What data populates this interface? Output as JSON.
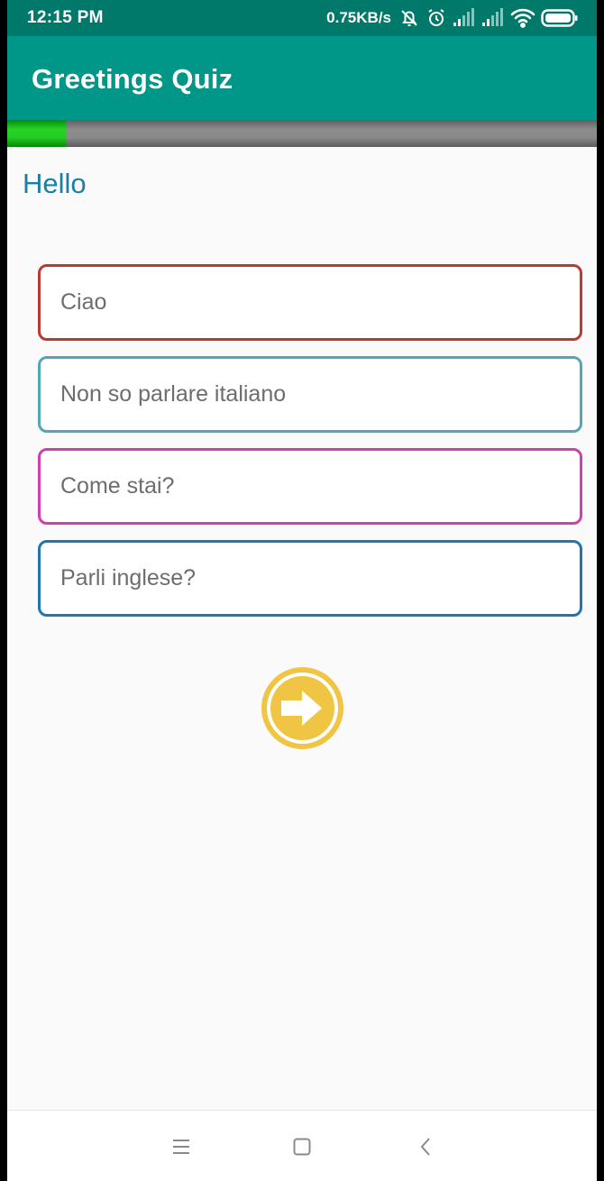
{
  "status_bar": {
    "time": "12:15 PM",
    "network_speed": "0.75KB/s",
    "icons": [
      "muted-bell-icon",
      "alarm-icon",
      "signal-icon",
      "signal-icon",
      "wifi-icon",
      "battery-icon"
    ]
  },
  "app_bar": {
    "title": "Greetings Quiz",
    "color": "#009688"
  },
  "progress": {
    "fraction": 0.1
  },
  "question": {
    "word": "Hello"
  },
  "answers": [
    {
      "label": "Ciao",
      "border_color": "#b83a32"
    },
    {
      "label": "Non so parlare italiano",
      "border_color": "#52a8b2"
    },
    {
      "label": "Come stai?",
      "border_color": "#d03fad"
    },
    {
      "label": "Parli inglese?",
      "border_color": "#2176b0"
    }
  ],
  "next_button": {
    "icon": "arrow-right-icon",
    "color": "#f1c544"
  },
  "nav_bar": {
    "icons": [
      "menu-icon",
      "home-square-icon",
      "back-chevron-icon"
    ]
  }
}
